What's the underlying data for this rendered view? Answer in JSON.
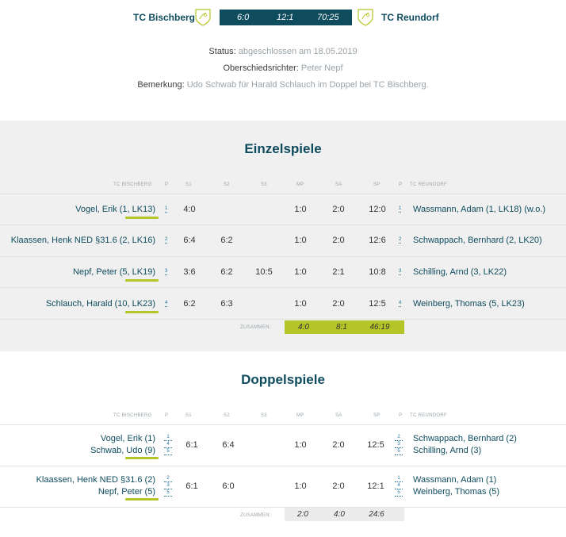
{
  "match": {
    "home_team": "TC Bischberg",
    "away_team": "TC Reundorf",
    "score": {
      "matches": "6:0",
      "sets": "12:1",
      "games": "70:25"
    }
  },
  "info": {
    "status_label": "Status:",
    "status_value": "abgeschlossen am 18.05.2019",
    "referee_label": "Oberschiedsrichter:",
    "referee_value": "Peter Nepf",
    "remark_label": "Bemerkung:",
    "remark_value": "Udo Schwab für Harald Schlauch im Doppel bei TC Bischberg."
  },
  "columns": {
    "home": "TC BISCHBERG",
    "p": "P",
    "s1": "S1",
    "s2": "S2",
    "s3": "S3",
    "mp": "MP",
    "sa": "SÄ",
    "sp": "SP",
    "p2": "P",
    "away": "TC REUNDORF"
  },
  "singles": {
    "title": "Einzelspiele",
    "rows": [
      {
        "home": "Vogel, Erik (1, LK13)",
        "hp": "1",
        "s1": "4:0",
        "s2": "",
        "s3": "",
        "mp": "1:0",
        "sa": "2:0",
        "sp": "12:0",
        "ap": "1",
        "away": "Wassmann, Adam (1, LK18) (w.o.)"
      },
      {
        "home": "Klaassen, Henk NED §31.6 (2, LK16)",
        "hp": "2",
        "s1": "6:4",
        "s2": "6:2",
        "s3": "",
        "mp": "1:0",
        "sa": "2:0",
        "sp": "12:6",
        "ap": "2",
        "away": "Schwappach, Bernhard (2, LK20)"
      },
      {
        "home": "Nepf, Peter (5, LK19)",
        "hp": "3",
        "s1": "3:6",
        "s2": "6:2",
        "s3": "10:5",
        "mp": "1:0",
        "sa": "2:1",
        "sp": "10:8",
        "ap": "3",
        "away": "Schilling, Arnd (3, LK22)"
      },
      {
        "home": "Schlauch, Harald (10, LK23)",
        "hp": "4",
        "s1": "6:2",
        "s2": "6:3",
        "s3": "",
        "mp": "1:0",
        "sa": "2:0",
        "sp": "12:5",
        "ap": "4",
        "away": "Weinberg, Thomas (5, LK23)"
      }
    ],
    "total_label": "ZUSAMMEN:",
    "total": {
      "mp": "4:0",
      "sa": "8:1",
      "sp": "46:19"
    }
  },
  "doubles": {
    "title": "Doppelspiele",
    "rows": [
      {
        "home1": "Vogel, Erik (1)",
        "home2": "Schwab, Udo (9)",
        "hp": [
          "1",
          "4",
          "5"
        ],
        "s1": "6:1",
        "s2": "6:4",
        "s3": "",
        "mp": "1:0",
        "sa": "2:0",
        "sp": "12:5",
        "ap": [
          "2",
          "3",
          "5"
        ],
        "away1": "Schwappach, Bernhard (2)",
        "away2": "Schilling, Arnd (3)"
      },
      {
        "home1": "Klaassen, Henk NED §31.6 (2)",
        "home2": "Nepf, Peter (5)",
        "hp": [
          "2",
          "3",
          "5"
        ],
        "s1": "6:1",
        "s2": "6:0",
        "s3": "",
        "mp": "1:0",
        "sa": "2:0",
        "sp": "12:1",
        "ap": [
          "1",
          "4",
          "5"
        ],
        "away1": "Wassmann, Adam (1)",
        "away2": "Weinberg, Thomas (5)"
      }
    ],
    "total_label": "ZUSAMMEN:",
    "total": {
      "mp": "2:0",
      "sa": "4:0",
      "sp": "24:6"
    }
  },
  "colors": {
    "primary": "#0e4c5e",
    "accent": "#b5c427",
    "section_bg": "#f0f0f0"
  },
  "icons": {
    "home_logo": "shield-logo-icon",
    "away_logo": "shield-logo-icon"
  }
}
